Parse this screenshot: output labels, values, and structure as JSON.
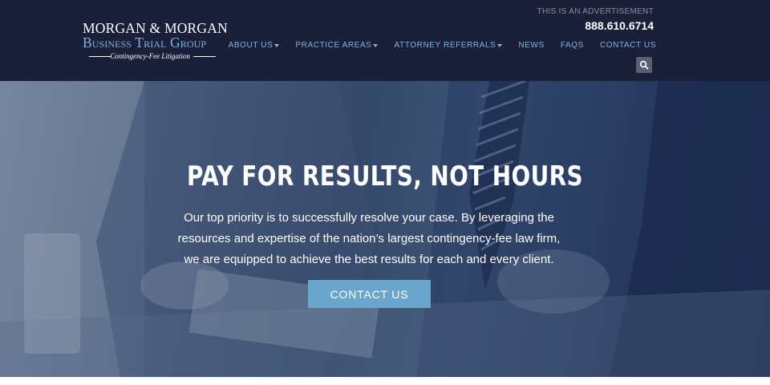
{
  "logo": {
    "line1": "MORGAN & MORGAN",
    "line2": "Business Trial Group",
    "tagline": "Contingency-Fee Litigation"
  },
  "header": {
    "advertisement": "THIS IS AN ADVERTISEMENT",
    "phone": "888.610.6714"
  },
  "nav": {
    "items": [
      {
        "label": "ABOUT US",
        "dropdown": true
      },
      {
        "label": "PRACTICE AREAS",
        "dropdown": true
      },
      {
        "label": "ATTORNEY REFERRALS",
        "dropdown": true
      },
      {
        "label": "NEWS",
        "dropdown": false
      },
      {
        "label": "FAQS",
        "dropdown": false
      },
      {
        "label": "CONTACT US",
        "dropdown": false
      }
    ],
    "search_icon": "search-icon"
  },
  "hero": {
    "title": "PAY FOR RESULTS, NOT HOURS",
    "text": "Our top priority is to successfully resolve your case. By leveraging the resources and expertise of the nation’s largest contingency-fee law firm, we are equipped to achieve the best results for each and every client.",
    "cta_label": "CONTACT US"
  },
  "colors": {
    "header_bg": "#1b2039",
    "nav_text": "#7fb3dd",
    "cta_bg": "#6aa5cc"
  }
}
